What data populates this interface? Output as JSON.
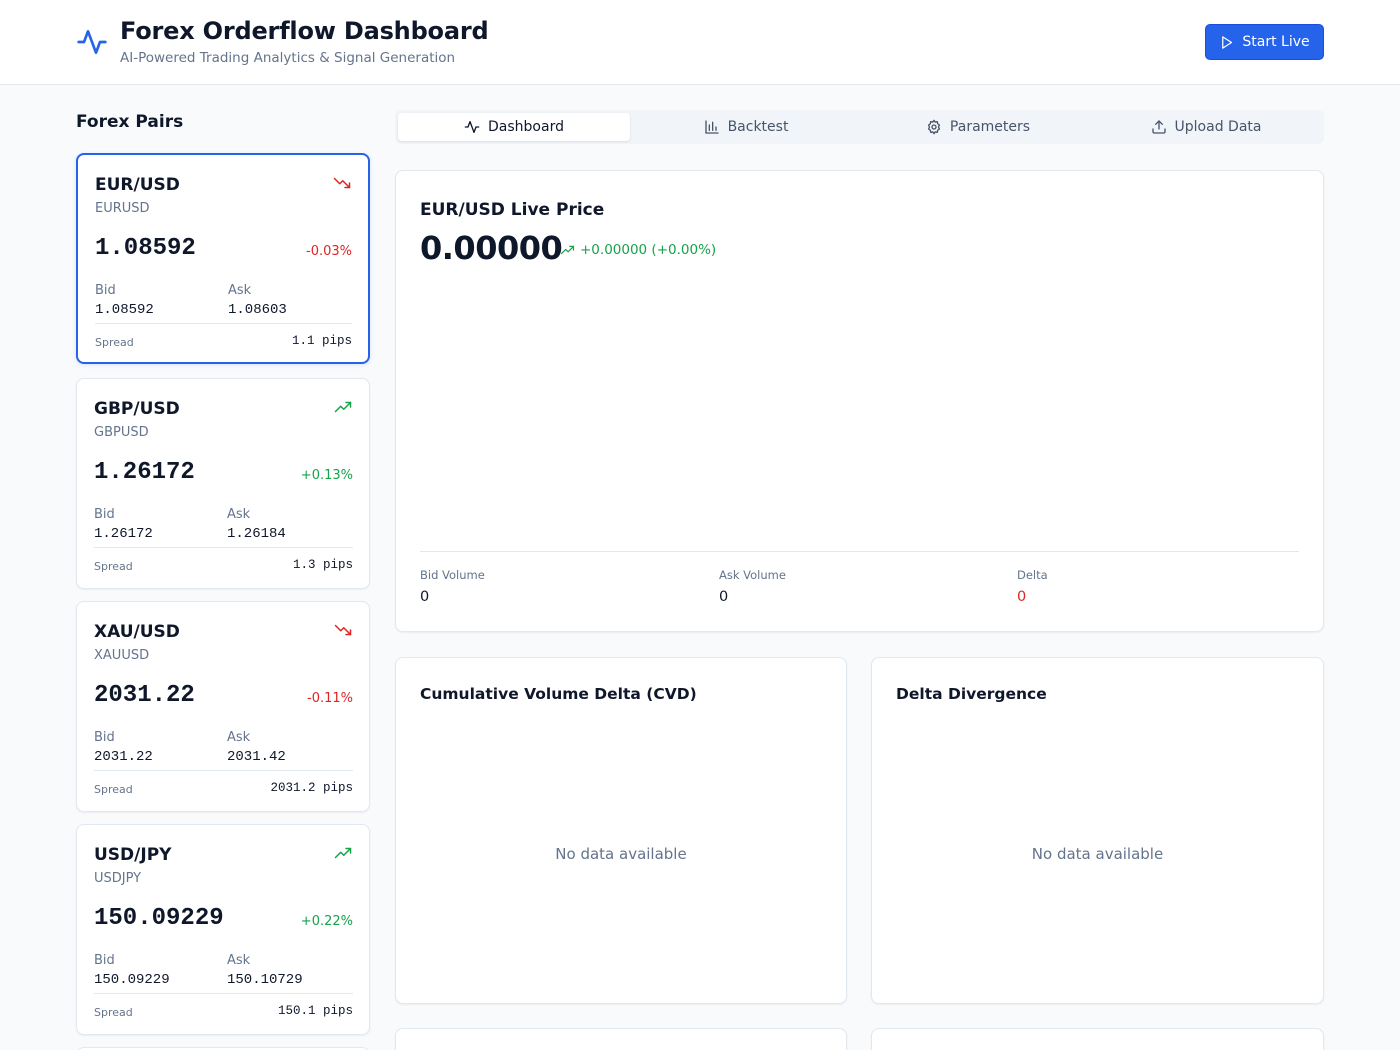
{
  "header": {
    "title": "Forex Orderflow Dashboard",
    "subtitle": "AI-Powered Trading Analytics & Signal Generation",
    "start_label": "Start Live"
  },
  "sidebar": {
    "title": "Forex Pairs",
    "pairs": [
      {
        "symbol": "EUR/USD",
        "code": "EURUSD",
        "price": "1.08592",
        "change": "-0.03%",
        "trend": "down",
        "bid_label": "Bid",
        "bid": "1.08592",
        "ask_label": "Ask",
        "ask": "1.08603",
        "spread_label": "Spread",
        "spread": "1.1 pips",
        "selected": true
      },
      {
        "symbol": "GBP/USD",
        "code": "GBPUSD",
        "price": "1.26172",
        "change": "+0.13%",
        "trend": "up",
        "bid_label": "Bid",
        "bid": "1.26172",
        "ask_label": "Ask",
        "ask": "1.26184",
        "spread_label": "Spread",
        "spread": "1.3 pips",
        "selected": false
      },
      {
        "symbol": "XAU/USD",
        "code": "XAUUSD",
        "price": "2031.22",
        "change": "-0.11%",
        "trend": "down",
        "bid_label": "Bid",
        "bid": "2031.22",
        "ask_label": "Ask",
        "ask": "2031.42",
        "spread_label": "Spread",
        "spread": "2031.2 pips",
        "selected": false
      },
      {
        "symbol": "USD/JPY",
        "code": "USDJPY",
        "price": "150.09229",
        "change": "+0.22%",
        "trend": "up",
        "bid_label": "Bid",
        "bid": "150.09229",
        "ask_label": "Ask",
        "ask": "150.10729",
        "spread_label": "Spread",
        "spread": "150.1 pips",
        "selected": false
      }
    ]
  },
  "tabs": [
    {
      "label": "Dashboard",
      "icon": "activity-icon",
      "active": true
    },
    {
      "label": "Backtest",
      "icon": "bar-chart-icon",
      "active": false
    },
    {
      "label": "Parameters",
      "icon": "gear-icon",
      "active": false
    },
    {
      "label": "Upload Data",
      "icon": "upload-icon",
      "active": false
    }
  ],
  "live": {
    "title": "EUR/USD Live Price",
    "price": "0.00000",
    "change": "+0.00000 (+0.00%)",
    "bid_volume_label": "Bid Volume",
    "bid_volume": "0",
    "ask_volume_label": "Ask Volume",
    "ask_volume": "0",
    "delta_label": "Delta",
    "delta": "0"
  },
  "cvd": {
    "title": "Cumulative Volume Delta (CVD)",
    "empty": "No data available"
  },
  "divergence": {
    "title": "Delta Divergence",
    "empty": "No data available"
  },
  "colors": {
    "accent": "#2563eb",
    "up": "#16a34a",
    "down": "#dc2626",
    "muted": "#64748b",
    "border": "#e2e8f0"
  }
}
